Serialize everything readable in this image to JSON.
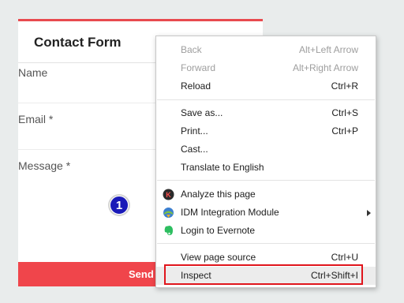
{
  "form": {
    "title": "Contact Form",
    "name_label": "Name",
    "email_label": "Email *",
    "message_label": "Message *",
    "send_label": "Send"
  },
  "step_badge": "1",
  "context_menu": {
    "items": [
      {
        "label": "Back",
        "shortcut": "Alt+Left Arrow",
        "disabled": true
      },
      {
        "label": "Forward",
        "shortcut": "Alt+Right Arrow",
        "disabled": true
      },
      {
        "label": "Reload",
        "shortcut": "Ctrl+R"
      },
      {
        "label": "Save as...",
        "shortcut": "Ctrl+S"
      },
      {
        "label": "Print...",
        "shortcut": "Ctrl+P"
      },
      {
        "label": "Cast..."
      },
      {
        "label": "Translate to English"
      },
      {
        "label": "Analyze this page",
        "icon": "k-extension-icon"
      },
      {
        "label": "IDM Integration Module",
        "icon": "idm-icon",
        "submenu": true
      },
      {
        "label": "Login to Evernote",
        "icon": "evernote-icon"
      },
      {
        "label": "View page source",
        "shortcut": "Ctrl+U"
      },
      {
        "label": "Inspect",
        "shortcut": "Ctrl+Shift+I",
        "highlighted": true
      }
    ]
  },
  "colors": {
    "accent": "#f0454b",
    "highlight_border": "#e0151c",
    "badge": "#1a1ab8"
  }
}
